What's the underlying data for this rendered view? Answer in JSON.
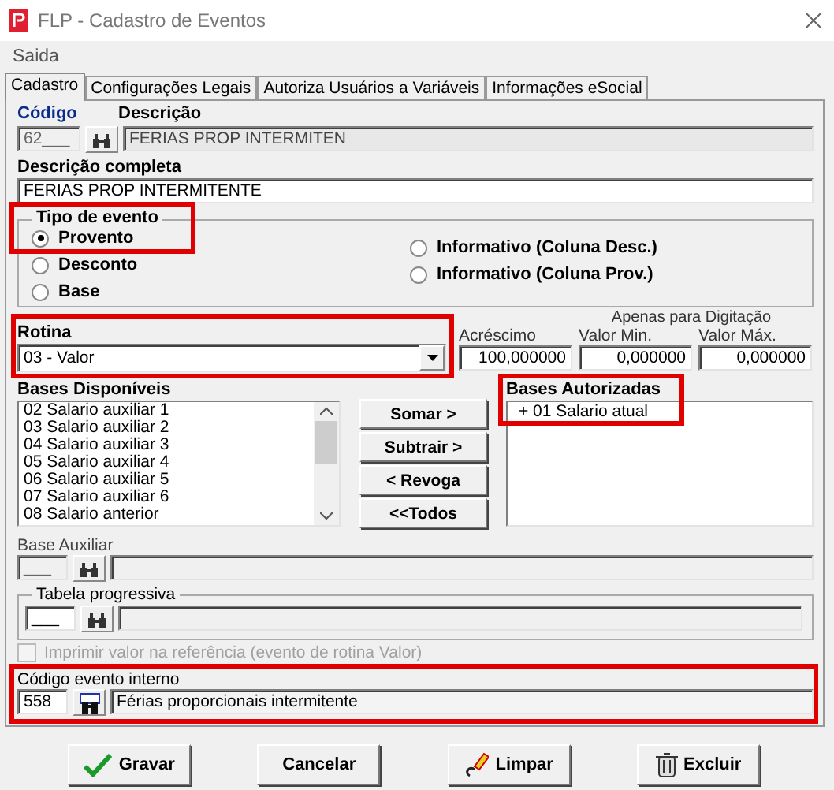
{
  "window": {
    "title": "FLP - Cadastro de Eventos"
  },
  "menu": [
    "Saida"
  ],
  "tabs": [
    {
      "label": "Cadastro",
      "selected": true
    },
    {
      "label": "Configurações Legais",
      "selected": false
    },
    {
      "label": "Autoriza Usuários a Variáveis",
      "selected": false
    },
    {
      "label": "Informações eSocial",
      "selected": false
    }
  ],
  "codigo": {
    "label": "Código",
    "value": "62___",
    "disabled": true
  },
  "descricao": {
    "label": "Descrição",
    "value": "FERIAS PROP INTERMITEN",
    "disabled": true
  },
  "descricao_completa": {
    "label": "Descrição completa",
    "value": "FERIAS PROP INTERMITENTE"
  },
  "tipo_evento": {
    "label": "Tipo de evento",
    "highlighted": true,
    "options": [
      {
        "label": "Provento",
        "selected": true
      },
      {
        "label": "Desconto",
        "selected": false
      },
      {
        "label": "Base",
        "selected": false
      },
      {
        "label": "Informativo (Coluna Desc.)",
        "selected": false
      },
      {
        "label": "Informativo (Coluna Prov.)",
        "selected": false
      }
    ]
  },
  "rotina": {
    "label": "Rotina",
    "value": "03 - Valor",
    "highlighted": true
  },
  "digitacao": {
    "caption": "Apenas para Digitação",
    "fields": [
      {
        "label": "Acréscimo",
        "value": "100,000000"
      },
      {
        "label": "Valor Min.",
        "value": "0,000000"
      },
      {
        "label": "Valor Máx.",
        "value": "0,000000"
      }
    ]
  },
  "bases_disponiveis": {
    "label": "Bases Disponíveis",
    "items": [
      "02 Salario auxiliar 1",
      "03 Salario auxiliar 2",
      "04 Salario auxiliar 3",
      "05 Salario auxiliar 4",
      "06 Salario auxiliar 5",
      "07 Salario auxiliar 6",
      "08 Salario anterior"
    ]
  },
  "actions": [
    "Somar >",
    "Subtrair >",
    "< Revoga",
    "<<Todos"
  ],
  "bases_autorizadas": {
    "label": "Bases Autorizadas",
    "highlighted": true,
    "items": [
      "+ 01 Salario atual"
    ]
  },
  "base_auxiliar": {
    "label": "Base Auxiliar",
    "value": "___"
  },
  "tabela_progressiva": {
    "label": "Tabela progressiva",
    "value": "___"
  },
  "imprimir": {
    "label": "Imprimir valor na referência (evento de rotina Valor)",
    "checked": false,
    "disabled": true
  },
  "codigo_evento_interno": {
    "label": "Código evento interno",
    "code": "558",
    "description": "Férias proporcionais intermitente",
    "highlighted": true
  },
  "buttons": [
    {
      "label": "Gravar",
      "kind": "save"
    },
    {
      "label": "Cancelar",
      "kind": "cancel"
    },
    {
      "label": "Limpar",
      "kind": "clear"
    },
    {
      "label": "Excluir",
      "kind": "delete"
    }
  ]
}
